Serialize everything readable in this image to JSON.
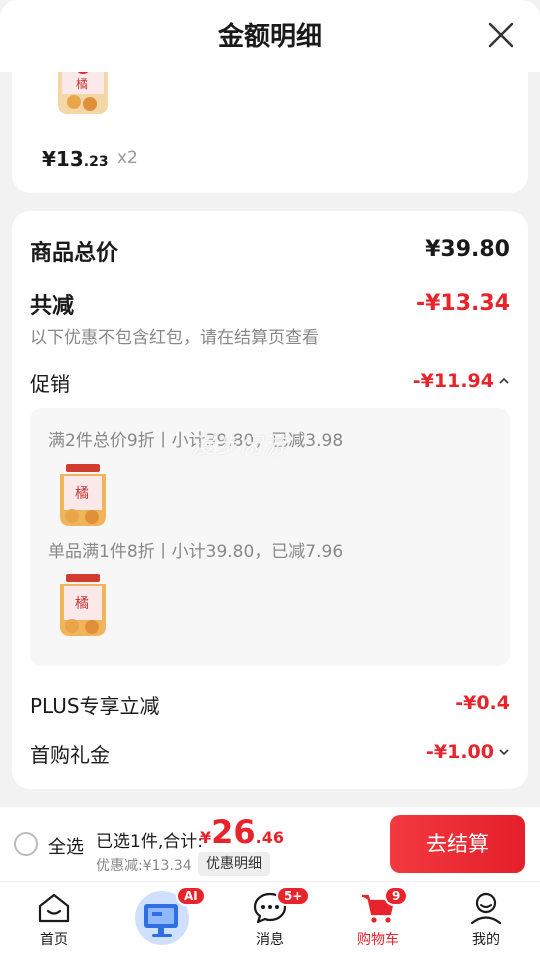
{
  "header": {
    "title": "金额明细",
    "close_icon": "close-icon"
  },
  "product": {
    "price_symbol": "¥",
    "price_int": "13",
    "price_dec": ".23",
    "quantity": "x2"
  },
  "summary": {
    "total_label": "商品总价",
    "total_value": "¥39.80",
    "reduction_label": "共减",
    "reduction_value": "-¥13.34",
    "note": "以下优惠不包含红包，请在结算页查看",
    "promo_label": "促销",
    "promo_value": "-¥11.94",
    "promo_lines": [
      "满2件总价9折丨小计39.80，已减3.98",
      "单品满1件8折丨小计39.80，已减7.96"
    ],
    "plus_label": "PLUS专享立减",
    "plus_value": "-¥0.4",
    "gift_label": "首购礼金",
    "gift_value": "-¥1.00"
  },
  "watermark": "漫步闲游",
  "checkout": {
    "select_all": "全选",
    "selected_info": "已选1件,合计:",
    "total_yen": "¥",
    "total_int": "26",
    "total_dec": ".46",
    "discount": "优惠减:¥13.34",
    "detail_button": "优惠明细",
    "pay_button": "去结算"
  },
  "tabbar": {
    "items": [
      {
        "label": "首页",
        "icon": "home-icon"
      },
      {
        "label": "",
        "icon": "ai-assistant-icon",
        "badge": "AI"
      },
      {
        "label": "消息",
        "icon": "message-icon",
        "badge": "5+"
      },
      {
        "label": "购物车",
        "icon": "cart-icon",
        "badge": "9"
      },
      {
        "label": "我的",
        "icon": "profile-icon"
      }
    ]
  },
  "colors": {
    "accent": "#e8232b",
    "background": "#f2f2f2"
  }
}
